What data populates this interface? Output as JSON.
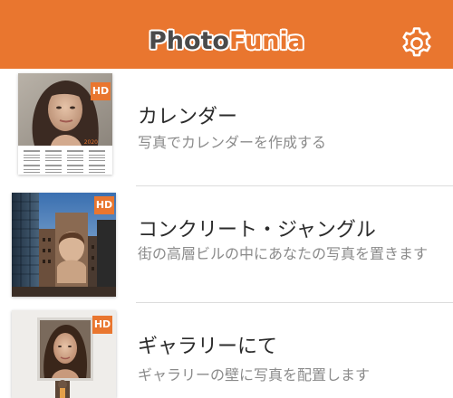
{
  "header": {
    "logo_part1": "Photo",
    "logo_part2": "Funia",
    "settings_icon": "gear-icon",
    "background_color": "#e9762f"
  },
  "effects": [
    {
      "title": "カレンダー",
      "description": "写真でカレンダーを作成する",
      "badge": "HD",
      "calendar_year": "2020"
    },
    {
      "title": "コンクリート・ジャングル",
      "description": "街の高層ビルの中にあなたの写真を置きます",
      "badge": "HD"
    },
    {
      "title": "ギャラリーにて",
      "description": "ギャラリーの壁に写真を配置します",
      "badge": "HD"
    }
  ]
}
